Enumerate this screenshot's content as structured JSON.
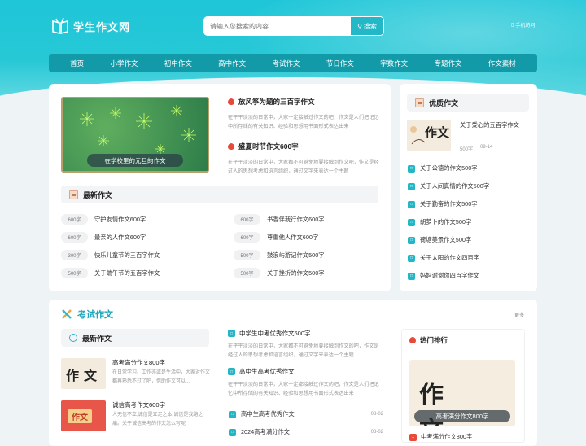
{
  "site": {
    "title": "学生作文网",
    "mobile": "手机访问"
  },
  "search": {
    "placeholder": "请输入您搜索的内容",
    "button": "搜索"
  },
  "nav": [
    "首页",
    "小学作文",
    "初中作文",
    "高中作文",
    "考试作文",
    "节日作文",
    "字数作文",
    "专题作文",
    "作文素材"
  ],
  "featured": {
    "banner_caption": "在学校里的元旦的作文",
    "articles": [
      {
        "title": "放风筝为题的三百字作文",
        "desc": "在平平淡淡的日常中，大家一定接触过作文的吧，作文是人们把记忆中所存储的有关知识、经验和思想用书面形式表达出来"
      },
      {
        "title": "盛夏时节作文600字",
        "desc": "在平平淡淡的日常中，大家都不可避免地要接触到作文吧，作文是经过人的思想考虑和语言组织，通过文字来表达一个主题"
      }
    ]
  },
  "latest": {
    "heading": "最新作文",
    "left": [
      {
        "tag": "600字",
        "title": "守护友情作文600字"
      },
      {
        "tag": "600字",
        "title": "最亲的人作文600字"
      },
      {
        "tag": "300字",
        "title": "快乐儿童节的三百字作文"
      },
      {
        "tag": "500字",
        "title": "关于端午节的五百字作文"
      }
    ],
    "right": [
      {
        "tag": "600字",
        "title": "书香伴我行作文600字"
      },
      {
        "tag": "600字",
        "title": "尊重他人作文600字"
      },
      {
        "tag": "500字",
        "title": "鼓浪屿游记作文500字"
      },
      {
        "tag": "500字",
        "title": "关于挫折的作文500字"
      }
    ]
  },
  "quality": {
    "heading": "优质作文",
    "top": {
      "title": "关于爱心的五百字作文",
      "tag": "500字",
      "date": "09-14",
      "img_text": "作文"
    },
    "items": [
      "关于公德的作文500字",
      "关于人间真情的作文500字",
      "关于勤奋的作文500字",
      "胡萝卜的作文500字",
      "荷塘美景作文500字",
      "关于太阳的作文四百字",
      "妈妈谢谢你四百字作文"
    ]
  },
  "exam": {
    "title": "考试作文",
    "more": "更多",
    "latest_heading": "最新作文",
    "news": [
      {
        "title": "高考满分作文800字",
        "desc": "在日常学习、工作亦或是生活中，大家对作文都再熟悉不过了吧，借助作文可以...",
        "img_text": "作文"
      },
      {
        "title": "诚信高考作文600字",
        "desc": "人无信不立,诚信是立足之本,诚信是我路之痛。关于诚信高考的作文怎么写呢",
        "img_text": "作文"
      }
    ],
    "mid_articles": [
      {
        "title": "中学生中考优秀作文600字",
        "desc": "在平平淡淡的日常中，大家都不可避免地要接触到作文的吧，作文是经过人的思想考虑和语言组织，通过文字来表达一个主题"
      },
      {
        "title": "高中生高考优秀作文",
        "desc": "在平平淡淡的日常中，大家一定都接触过作文的吧，作文是人们把记忆中所存储的有关知识、经验和思想用书面形式表达出来"
      }
    ],
    "rows": [
      {
        "title": "高中生高考优秀作文",
        "date": "08-02"
      },
      {
        "title": "2024高考满分作文",
        "date": "08-02"
      }
    ],
    "hot": {
      "heading": "热门排行",
      "caption": "高考满分作文800字",
      "img_text": "作文",
      "first": "中考满分作文800字"
    }
  },
  "colors": {
    "accent": "#21b7c6",
    "nav": "#129aa8",
    "hot": "#e84a3a"
  }
}
